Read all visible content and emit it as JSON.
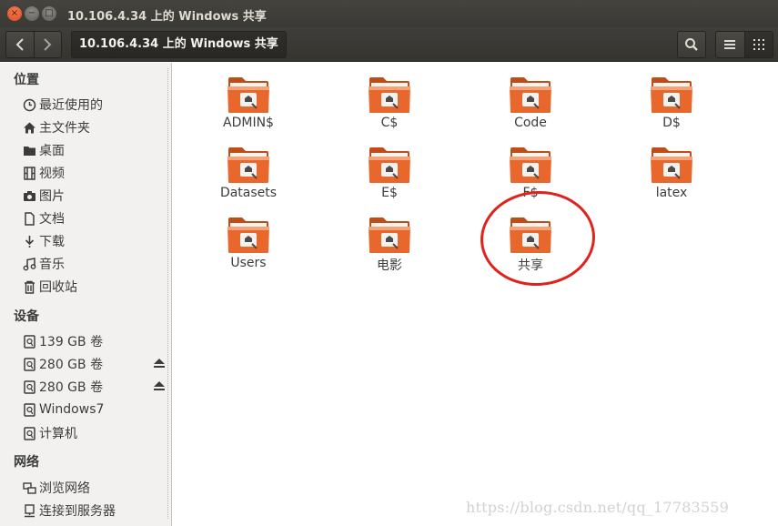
{
  "window": {
    "title": "10.106.4.34 上的 Windows 共享",
    "controls": {
      "close": "×",
      "minimize": "−",
      "maximize": "□"
    }
  },
  "toolbar": {
    "back_icon": "chevron-left-icon",
    "forward_icon": "chevron-right-icon",
    "path_label": "10.106.4.34 上的 Windows 共享",
    "search_icon": "search-icon",
    "list_view_icon": "list-view-icon",
    "grid_view_icon": "grid-view-icon"
  },
  "sidebar": {
    "places_header": "位置",
    "places": [
      {
        "label": "最近使用的",
        "icon": "clock-icon"
      },
      {
        "label": "主文件夹",
        "icon": "home-icon"
      },
      {
        "label": "桌面",
        "icon": "desktop-folder-icon"
      },
      {
        "label": "视频",
        "icon": "film-icon"
      },
      {
        "label": "图片",
        "icon": "camera-icon"
      },
      {
        "label": "文档",
        "icon": "document-icon"
      },
      {
        "label": "下载",
        "icon": "download-icon"
      },
      {
        "label": "音乐",
        "icon": "music-icon"
      },
      {
        "label": "回收站",
        "icon": "trash-icon"
      }
    ],
    "devices_header": "设备",
    "devices": [
      {
        "label": "139 GB 卷",
        "icon": "drive-icon",
        "eject": false
      },
      {
        "label": "280 GB 卷",
        "icon": "drive-icon",
        "eject": true
      },
      {
        "label": "280 GB 卷",
        "icon": "drive-icon",
        "eject": true
      },
      {
        "label": "Windows7",
        "icon": "drive-icon",
        "eject": false
      },
      {
        "label": "计算机",
        "icon": "drive-icon",
        "eject": false
      }
    ],
    "network_header": "网络",
    "network": [
      {
        "label": "浏览网络",
        "icon": "network-icon"
      },
      {
        "label": "连接到服务器",
        "icon": "server-icon"
      }
    ]
  },
  "shares": [
    {
      "label": "ADMIN$"
    },
    {
      "label": "C$"
    },
    {
      "label": "Code"
    },
    {
      "label": "D$"
    },
    {
      "label": "Datasets"
    },
    {
      "label": "E$"
    },
    {
      "label": "F$"
    },
    {
      "label": "latex"
    },
    {
      "label": "Users"
    },
    {
      "label": "电影"
    },
    {
      "label": "共享"
    }
  ],
  "colors": {
    "folder_orange": "#e8672c",
    "folder_light": "#f3a37a",
    "annotation_red": "#e0221c",
    "titlebar": "#3c3b37"
  },
  "watermark": "https://blog.csdn.net/qq_17783559"
}
